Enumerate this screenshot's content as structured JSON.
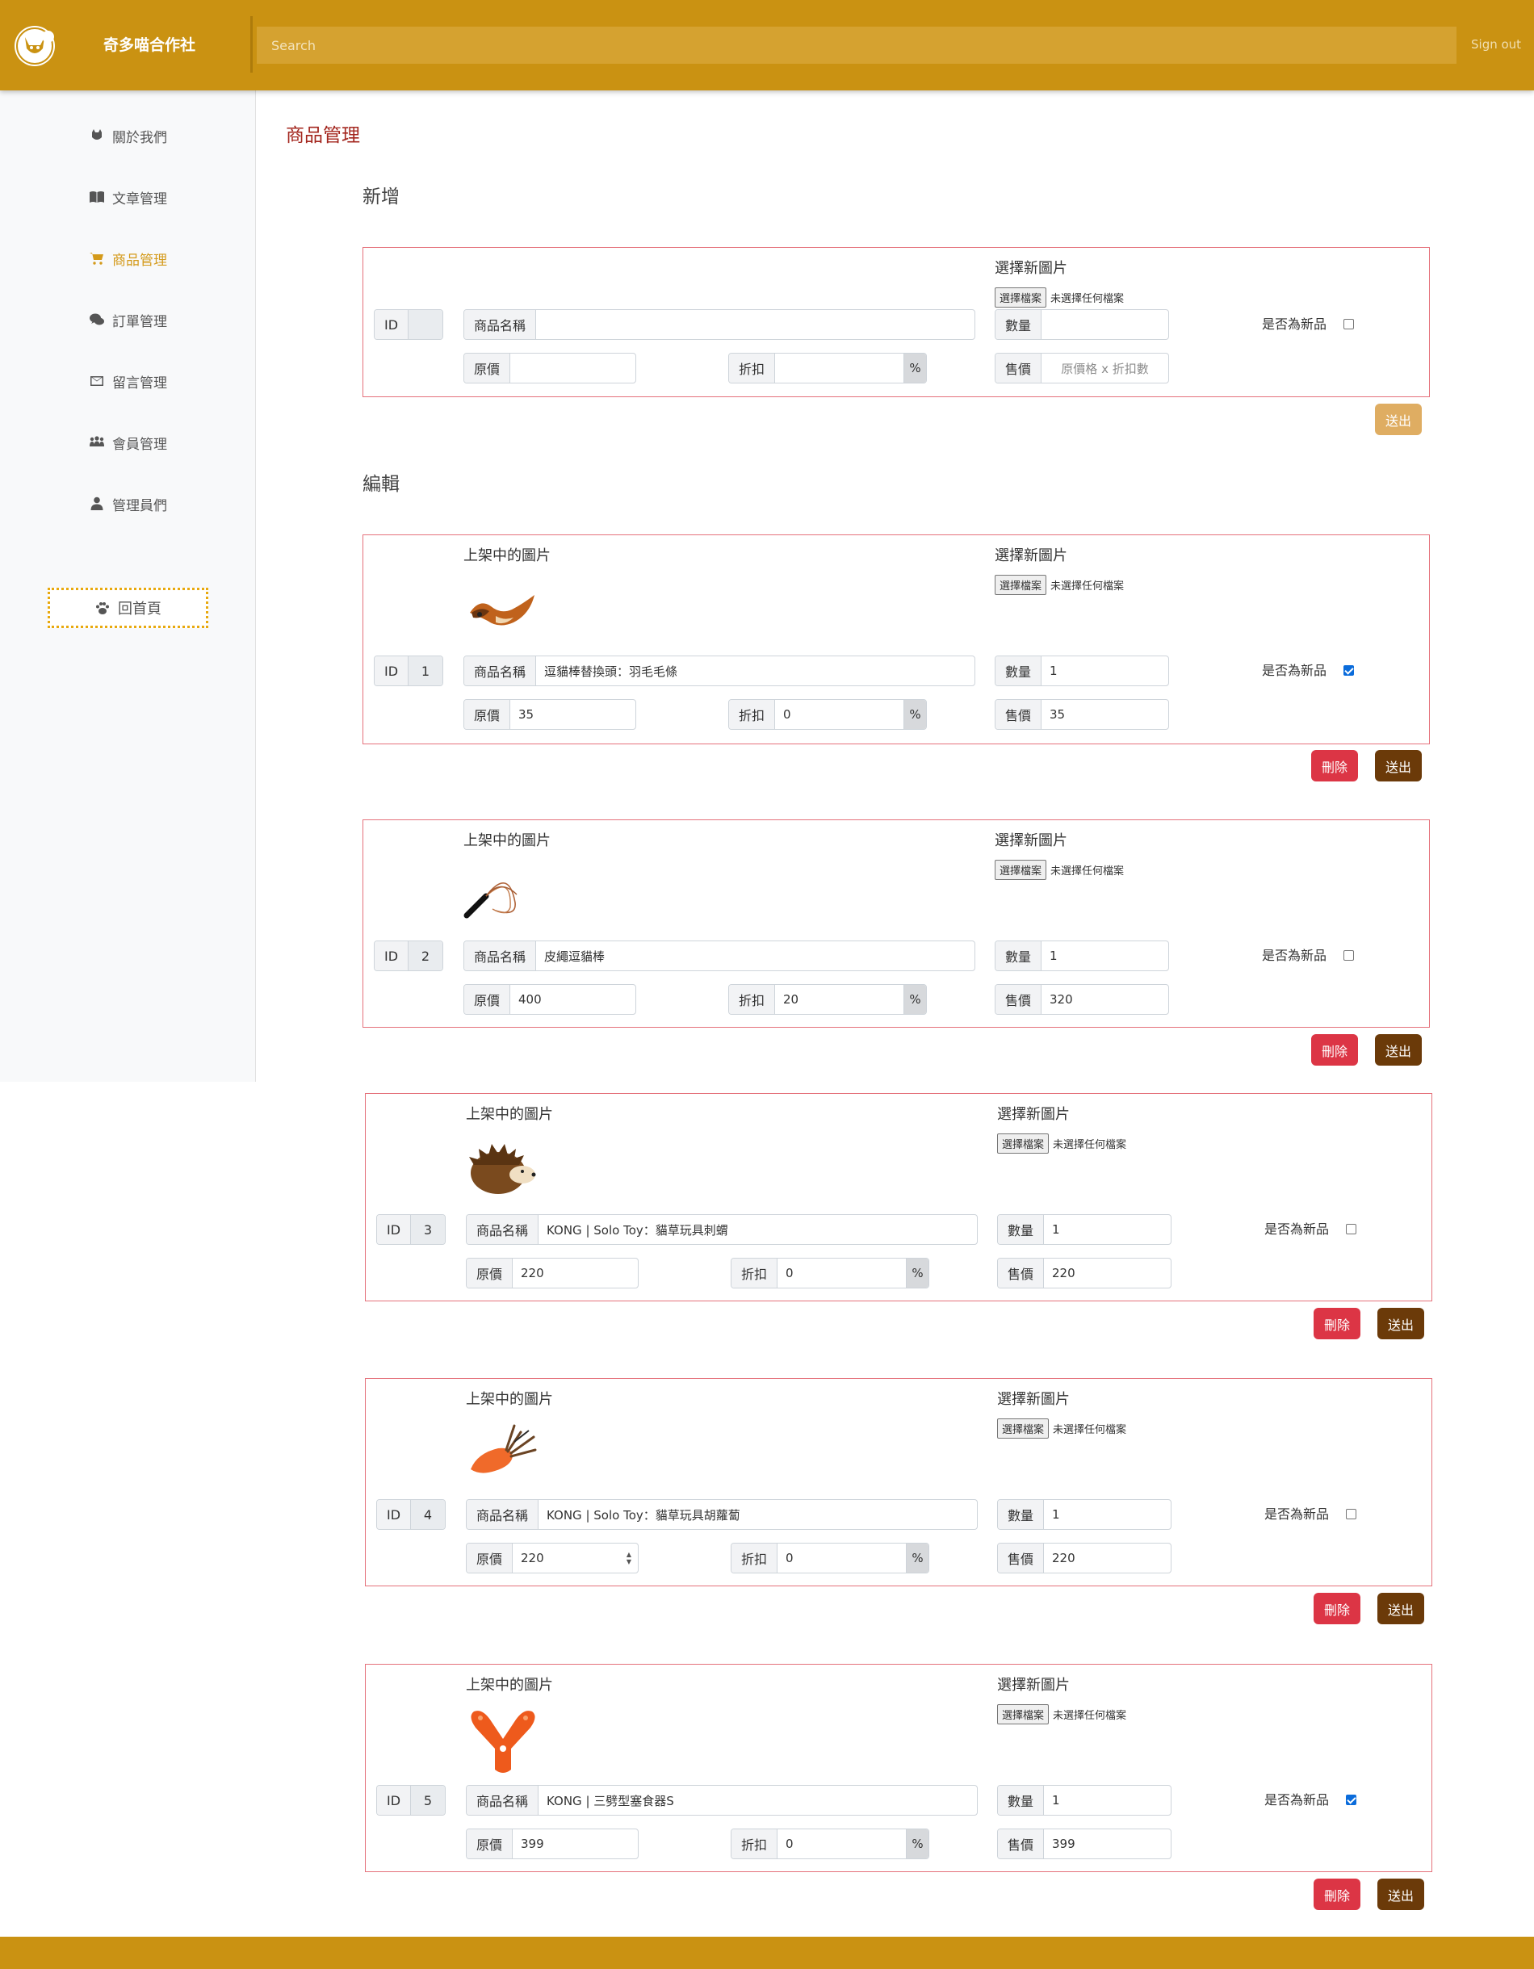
{
  "header": {
    "brand": "奇多喵合作社",
    "search_placeholder": "Search",
    "signout": "Sign out"
  },
  "sidebar": {
    "items": [
      {
        "label": "關於我們",
        "icon": "cat-icon"
      },
      {
        "label": "文章管理",
        "icon": "book-icon"
      },
      {
        "label": "商品管理",
        "icon": "cart-icon",
        "active": true
      },
      {
        "label": "訂單管理",
        "icon": "comments-dollar-icon"
      },
      {
        "label": "留言管理",
        "icon": "envelope-icon"
      },
      {
        "label": "會員管理",
        "icon": "users-icon"
      },
      {
        "label": "管理員們",
        "icon": "user-tie-icon"
      }
    ],
    "home_button": "回首頁"
  },
  "page_title": "商品管理",
  "add_section": {
    "title": "新增",
    "choose_image_label": "選擇新圖片",
    "file_button": "選擇檔案",
    "file_status": "未選擇任何檔案",
    "id_label": "ID",
    "id_value": "",
    "name_label": "商品名稱",
    "name_value": "",
    "qty_label": "數量",
    "qty_value": "",
    "is_new_label": "是否為新品",
    "is_new": false,
    "price_label": "原價",
    "price_value": "",
    "discount_label": "折扣",
    "discount_value": "",
    "percent": "%",
    "sale_label": "售價",
    "sale_placeholder": "原價格 x 折扣數",
    "submit": "送出"
  },
  "edit_section": {
    "title": "編輯",
    "current_image_label": "上架中的圖片",
    "choose_image_label": "選擇新圖片",
    "file_button": "選擇檔案",
    "file_status": "未選擇任何檔案",
    "id_label": "ID",
    "name_label": "商品名稱",
    "qty_label": "數量",
    "is_new_label": "是否為新品",
    "price_label": "原價",
    "discount_label": "折扣",
    "percent": "%",
    "sale_label": "售價",
    "delete": "刪除",
    "submit": "送出",
    "products": [
      {
        "id": "1",
        "name": "逗貓棒替換頭：羽毛毛條",
        "qty": "1",
        "is_new": true,
        "price": "35",
        "discount": "0",
        "sale": "35",
        "image": "feather-toy-image"
      },
      {
        "id": "2",
        "name": "皮繩逗貓棒",
        "qty": "1",
        "is_new": false,
        "price": "400",
        "discount": "20",
        "sale": "320",
        "image": "leather-wand-image"
      },
      {
        "id": "3",
        "name": "KONG | Solo Toy：貓草玩具刺蝟",
        "qty": "1",
        "is_new": false,
        "price": "220",
        "discount": "0",
        "sale": "220",
        "image": "hedgehog-toy-image"
      },
      {
        "id": "4",
        "name": "KONG | Solo Toy：貓草玩具胡蘿蔔",
        "qty": "1",
        "is_new": false,
        "price": "220",
        "discount": "0",
        "sale": "220",
        "image": "carrot-toy-image"
      },
      {
        "id": "5",
        "name": "KONG | 三劈型塞食器S",
        "qty": "1",
        "is_new": true,
        "price": "399",
        "discount": "0",
        "sale": "399",
        "image": "y-feeder-toy-image"
      }
    ]
  },
  "colors": {
    "brand": "#ca9212",
    "active": "#d49a1a",
    "card_border": "#e5717b",
    "title": "#a3261e",
    "delete": "#dc3545",
    "submit": "#6b3a09"
  }
}
